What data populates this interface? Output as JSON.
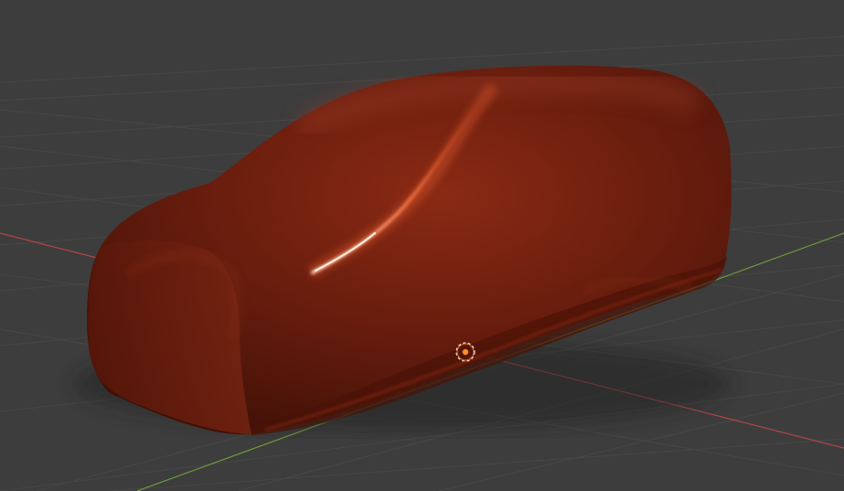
{
  "viewport": {
    "background": "#3d3d3d",
    "grid_color": "#4a4a4a",
    "x_axis_color": "#c44a4a",
    "y_axis_color": "#6e9a3a"
  },
  "object": {
    "kind": "car-body",
    "base_color": "#6b1c0d",
    "highlight_color": "#ff8a5c"
  },
  "origin_marker": {
    "icon": "object-origin-icon",
    "color": "#ff8c2a"
  }
}
